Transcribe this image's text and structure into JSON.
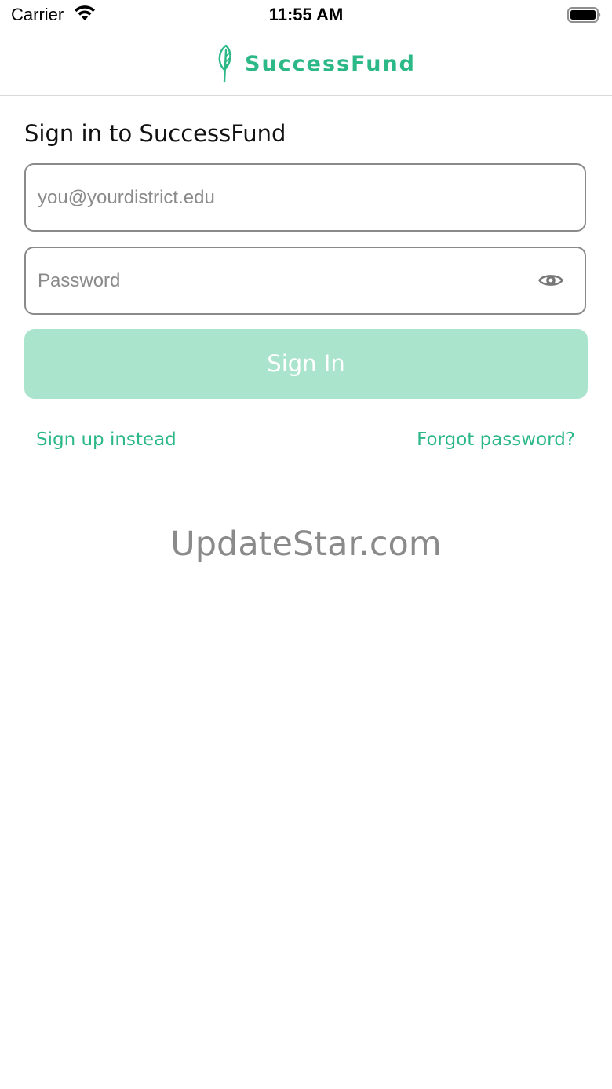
{
  "status_bar": {
    "carrier": "Carrier",
    "time": "11:55 AM",
    "wifi_icon": "wifi-icon",
    "battery_icon": "battery-full-icon"
  },
  "header": {
    "logo_icon": "leaf-icon",
    "app_name": "SuccessFund",
    "brand_color": "#2db887"
  },
  "form": {
    "title": "Sign in to SuccessFund",
    "email": {
      "placeholder": "you@yourdistrict.edu",
      "value": ""
    },
    "password": {
      "placeholder": "Password",
      "value": "",
      "toggle_icon": "eye-icon"
    },
    "submit_label": "Sign In",
    "submit_color": "#abe4cc",
    "signup_link": "Sign up instead",
    "forgot_link": "Forgot password?"
  },
  "watermark": "UpdateStar.com"
}
